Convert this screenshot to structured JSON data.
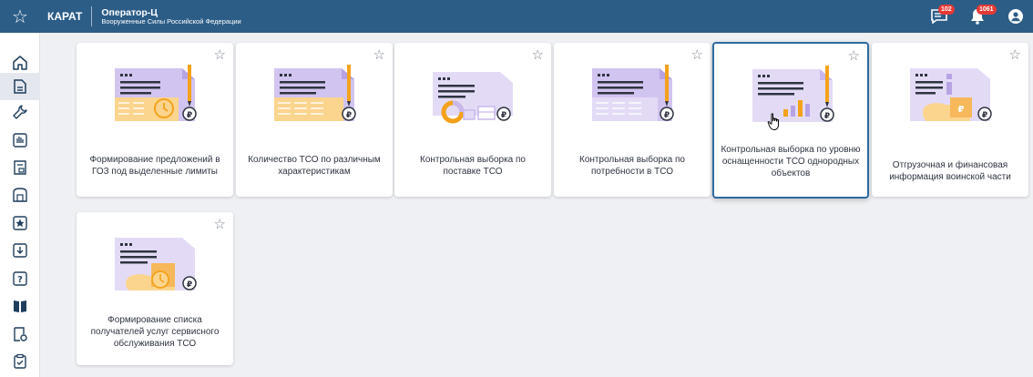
{
  "topbar": {
    "brand": "КАРАТ",
    "operator_title": "Оператор-Ц",
    "operator_subtitle": "Вооруженные Силы Российской Федерации",
    "messages_badge": "102",
    "notifications_badge": "1061",
    "bg_color": "#2c5d87"
  },
  "sidebar": {
    "items": [
      {
        "icon": "home-icon"
      },
      {
        "icon": "document-icon",
        "active": true
      },
      {
        "icon": "wrench-icon"
      },
      {
        "icon": "hand-icon"
      },
      {
        "icon": "receipt-icon"
      },
      {
        "icon": "building-icon"
      },
      {
        "icon": "star-badge-icon"
      },
      {
        "icon": "download-icon"
      },
      {
        "icon": "help-icon"
      },
      {
        "icon": "book-icon"
      },
      {
        "icon": "document-settings-icon"
      },
      {
        "icon": "clipboard-check-icon"
      }
    ]
  },
  "cards": [
    {
      "label": "Формирование предложений в ГОЗ под выделенные лимиты",
      "illustration": "table-clock-icon"
    },
    {
      "label": "Количество ТСО по различным характеристикам",
      "illustration": "table-icon"
    },
    {
      "label": "Контрольная выборка по поставке ТСО",
      "illustration": "delivery-icon"
    },
    {
      "label": "Контрольная выборка по потребности в ТСО",
      "illustration": "table-pen-icon"
    },
    {
      "label": "Контрольная выборка по уровню оснащенности ТСО однородных объектов",
      "illustration": "bar-chart-icon",
      "selected": true
    },
    {
      "label": "Отгрузочная и финансовая информация воинской части",
      "illustration": "finance-info-icon"
    },
    {
      "label": "Формирование списка получателей услуг сервисного обслуживания ТСО",
      "illustration": "service-clock-icon"
    }
  ],
  "colors": {
    "accent": "#2c6aa0",
    "illustration_purple": "#c9b8ec",
    "illustration_orange": "#f6b85a"
  }
}
